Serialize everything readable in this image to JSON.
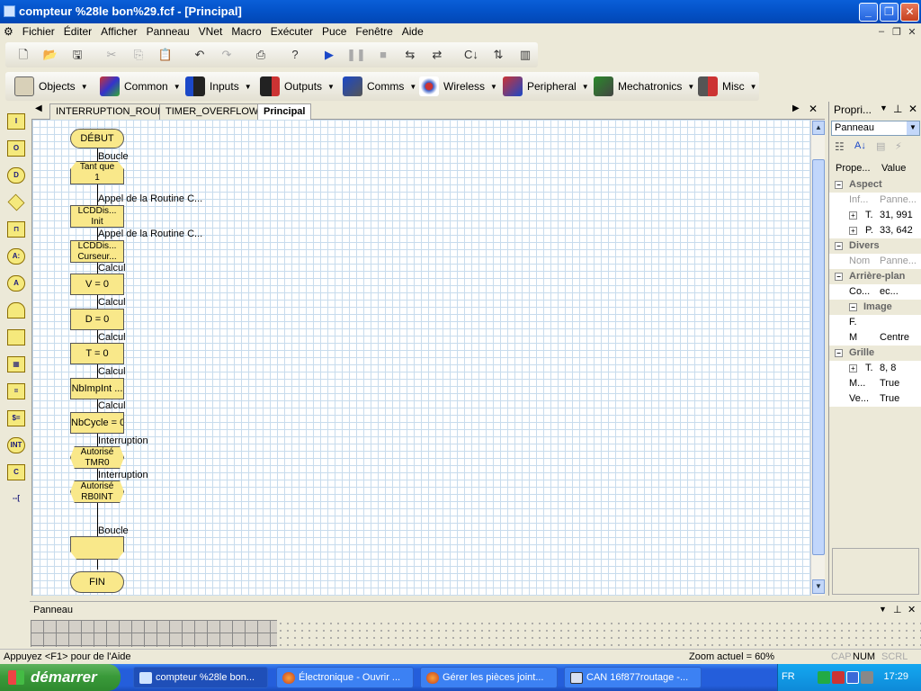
{
  "window": {
    "title": "compteur %28le bon%29.fcf - [Principal]"
  },
  "menu": [
    "Fichier",
    "Éditer",
    "Afficher",
    "Panneau",
    "VNet",
    "Macro",
    "Exécuter",
    "Puce",
    "Fenêtre",
    "Aide"
  ],
  "toolbar2": [
    {
      "label": "Objects",
      "color": "#1f4fb8"
    },
    {
      "label": "Common",
      "color": "#c33"
    },
    {
      "label": "Inputs",
      "color": "#1b48c8"
    },
    {
      "label": "Outputs",
      "color": "#c33"
    },
    {
      "label": "Comms",
      "color": "#1b48c8"
    },
    {
      "label": "Wireless",
      "color": "#3a5fc8"
    },
    {
      "label": "Peripheral",
      "color": "#c33"
    },
    {
      "label": "Mechatronics",
      "color": "#2a8a2a"
    },
    {
      "label": "Misc",
      "color": "#555"
    }
  ],
  "left_tools": [
    "I",
    "O",
    "D",
    "◆",
    "⊓",
    "A:",
    "A",
    "⌂",
    "□",
    "▦",
    "=",
    "$=",
    "INT",
    "C",
    "--["
  ],
  "tabs": [
    "INTERRUPTION_ROUE",
    "TIMER_OVERFLOW",
    "Principal"
  ],
  "flow": {
    "start": "DÉBUT",
    "loop_label": "Boucle",
    "loop_cond_1": "Tant que",
    "loop_cond_2": "1",
    "call_label_1": "Appel de la Routine C...",
    "call_1_line1": "LCDDis...",
    "call_1_line2": "Init",
    "call_label_2": "Appel de la Routine C...",
    "call_2_line1": "LCDDis...",
    "call_2_line2": "Curseur...",
    "calc_label": "Calcul",
    "calc_1": "V = 0",
    "calc_2": "D = 0",
    "calc_3": "T = 0",
    "calc_4": "NbImpInt ...",
    "calc_5": "NbCycle = 0",
    "int_label": "Interruption",
    "int_1_line1": "Autorisé",
    "int_1_line2": "TMR0",
    "int_2_line1": "Autorisé",
    "int_2_line2": "RB0INT",
    "loop_end_label": "Boucle",
    "end": "FIN"
  },
  "props": {
    "title": "Propri...",
    "select": "Panneau",
    "col_prop": "Prope...",
    "col_value": "Value",
    "rows": [
      {
        "type": "cat",
        "k": "Aspect"
      },
      {
        "type": "gray",
        "k": "Inf...",
        "v": "Panne..."
      },
      {
        "type": "item",
        "k": "T.",
        "v": "31, 991",
        "exp": true
      },
      {
        "type": "item",
        "k": "P.",
        "v": "33, 642",
        "exp": true
      },
      {
        "type": "cat",
        "k": "Divers"
      },
      {
        "type": "gray",
        "k": "Nom",
        "v": "Panne..."
      },
      {
        "type": "cat",
        "k": "Arrière-plan"
      },
      {
        "type": "item",
        "k": "Co...",
        "v": "ec..."
      },
      {
        "type": "cat",
        "k": "Image",
        "sub": true
      },
      {
        "type": "item",
        "k": "F.",
        "v": ""
      },
      {
        "type": "item",
        "k": "M",
        "v": "Centre"
      },
      {
        "type": "cat",
        "k": "Grille"
      },
      {
        "type": "item",
        "k": "T.",
        "v": "8, 8",
        "exp": true
      },
      {
        "type": "item",
        "k": "M...",
        "v": "True"
      },
      {
        "type": "item",
        "k": "Ve...",
        "v": "True"
      }
    ]
  },
  "panneau": {
    "title": "Panneau"
  },
  "status": {
    "help": "Appuyez <F1> pour de l'Aide",
    "zoom": "Zoom actuel = 60%",
    "cap": "CAP",
    "num": "NUM",
    "scrl": "SCRL"
  },
  "taskbar": {
    "start": "démarrer",
    "tasks": [
      "compteur %28le bon...",
      "Électronique - Ouvrir ...",
      "Gérer les pièces joint...",
      "CAN 16f877routage -..."
    ],
    "lang": "FR",
    "clock": "17:29"
  }
}
